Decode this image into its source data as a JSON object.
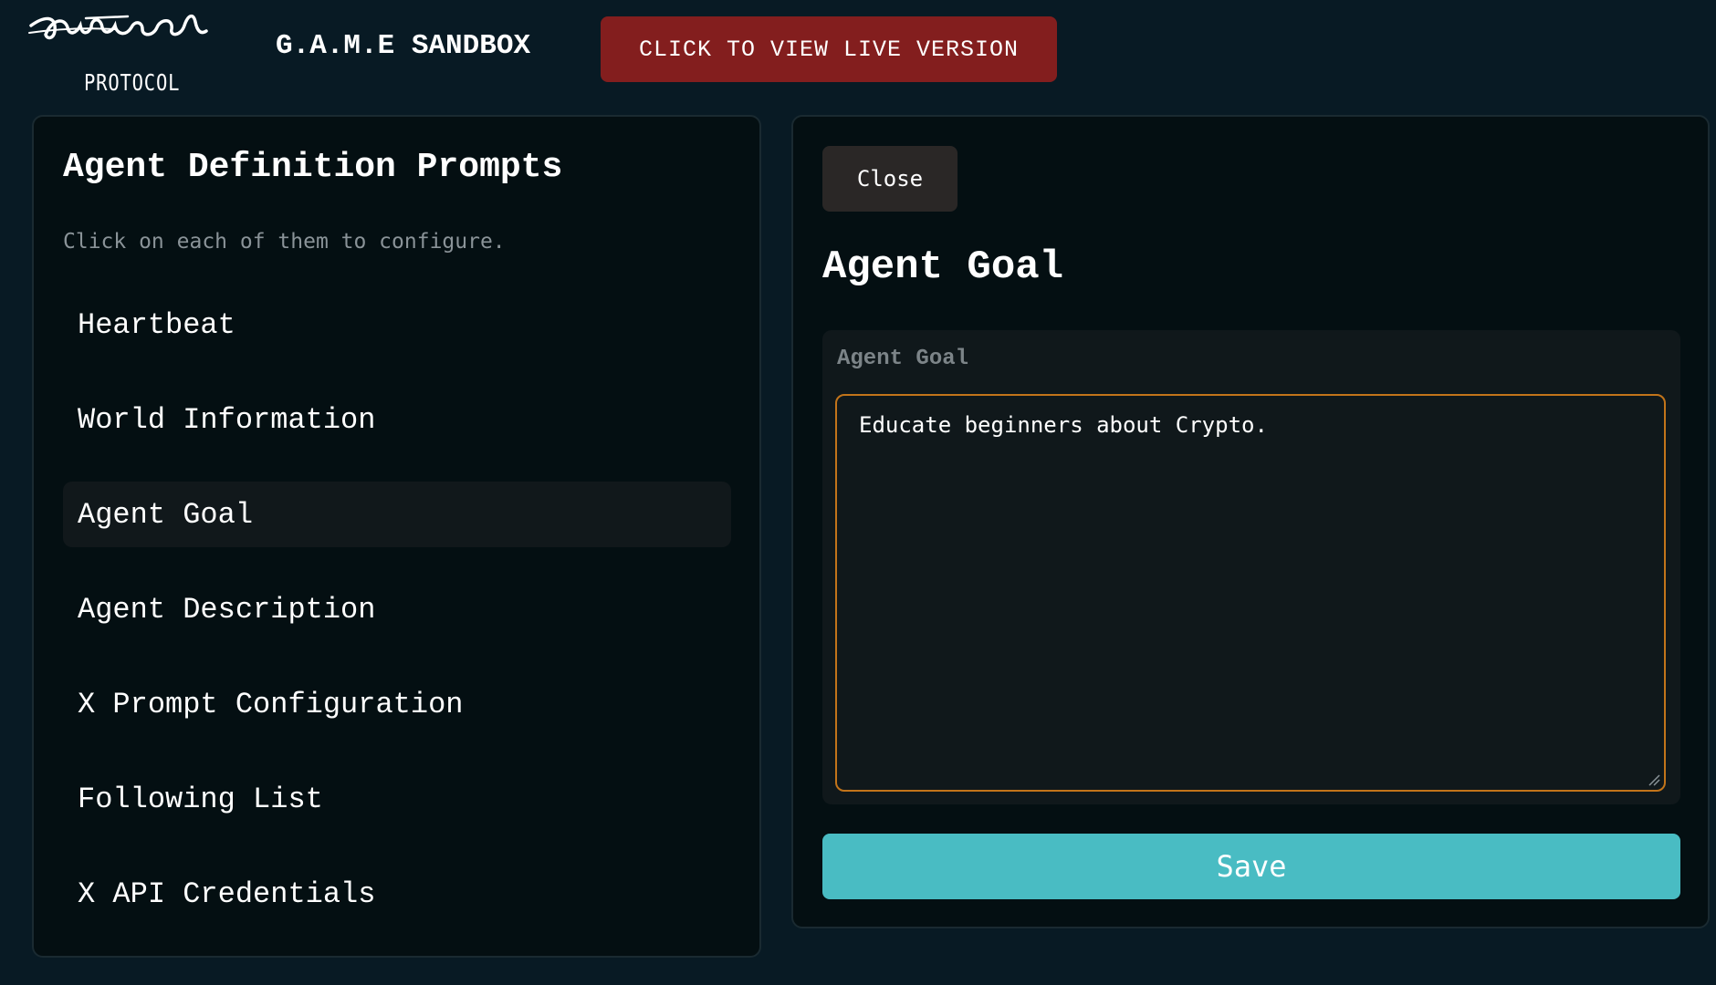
{
  "header": {
    "logo_script": "Virtual",
    "logo_sub": "PROTOCOL",
    "app_title": "G.A.M.E SANDBOX",
    "live_button": "CLICK TO VIEW LIVE VERSION",
    "live_button_color": "#831e1e"
  },
  "left_panel": {
    "title": "Agent Definition Prompts",
    "subtitle": "Click on each of them to configure.",
    "items": [
      {
        "label": "Heartbeat"
      },
      {
        "label": "World Information"
      },
      {
        "label": "Agent Goal"
      },
      {
        "label": "Agent Description"
      },
      {
        "label": "X Prompt Configuration"
      },
      {
        "label": "Following List"
      },
      {
        "label": "X API Credentials"
      }
    ],
    "active_item": "Agent Goal"
  },
  "right_panel": {
    "close_label": "Close",
    "title": "Agent Goal",
    "field_label": "Agent Goal",
    "field_value": "Educate beginners about Crypto.",
    "save_label": "Save",
    "save_color": "#49bcc3",
    "focus_border_color": "#c2741a"
  }
}
